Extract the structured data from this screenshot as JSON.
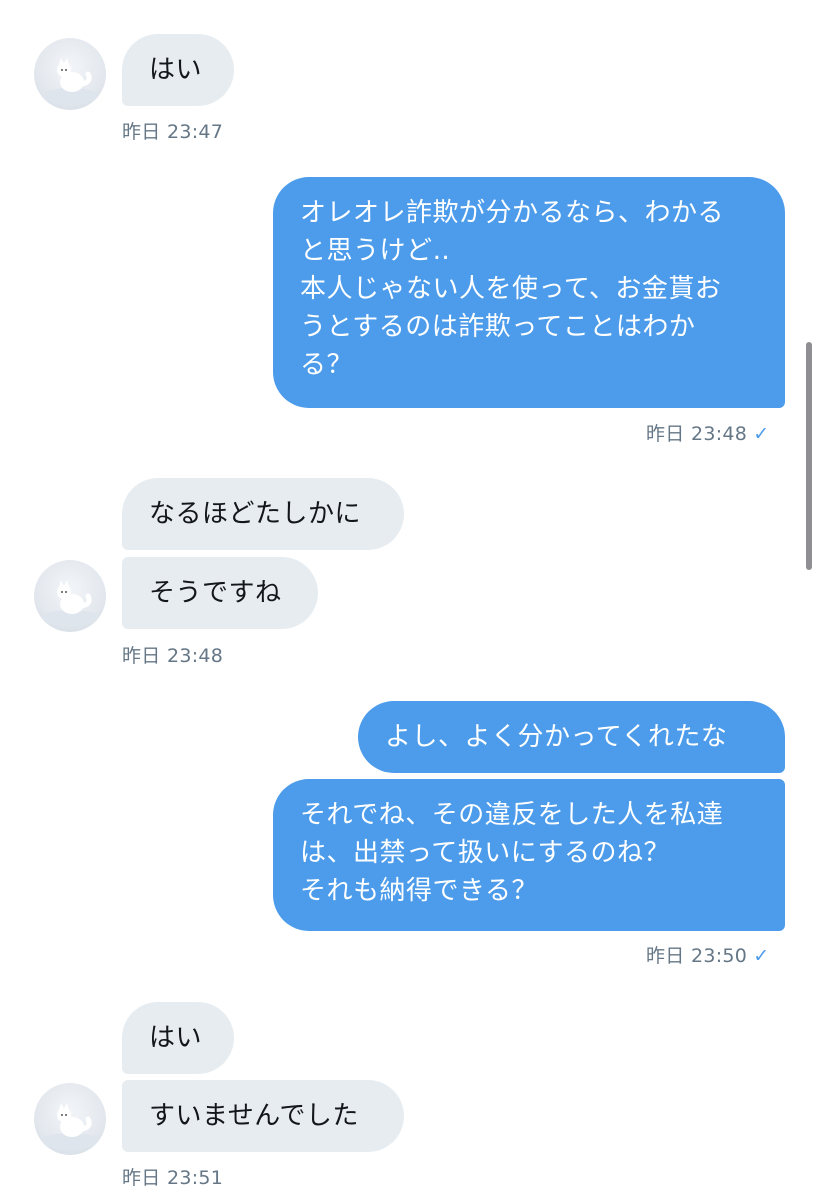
{
  "messages": [
    {
      "text": "はい"
    },
    {
      "text": "オレオレ詐欺が分かるなら、わかる\nと思うけど‥\n本人じゃない人を使って、お金貰お\nうとするのは詐欺ってことはわか\nる？"
    },
    {
      "text": "なるほどたしかに"
    },
    {
      "text": "そうですね"
    },
    {
      "text": "よし、よく分かってくれたな"
    },
    {
      "text": "それでね、その違反をした人を私達\nは、出禁って扱いにするのね？\nそれも納得できる？"
    },
    {
      "text": "はい"
    },
    {
      "text": "すいませんでした"
    }
  ],
  "timestamps": {
    "t1": "昨日 23:47",
    "t2": "昨日 23:48",
    "t3": "昨日 23:48",
    "t4": "昨日 23:50",
    "t5": "昨日 23:51"
  },
  "read_check": "✓",
  "colors": {
    "outgoing_bubble": "#4c9ceb",
    "incoming_bubble": "#e6ecf0",
    "timestamp": "#657786"
  },
  "icons": {
    "avatar": "arctic-fox-avatar-icon",
    "read": "checkmark-icon"
  }
}
